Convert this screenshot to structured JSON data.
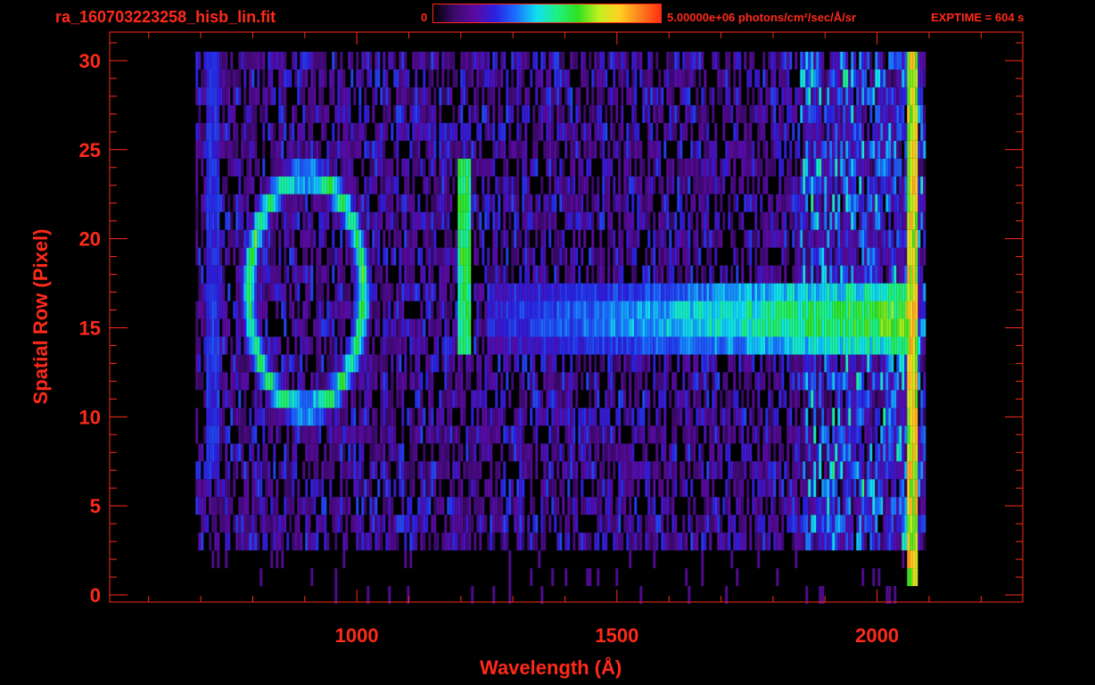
{
  "header": {
    "filename": "ra_160703223258_hisb_lin.fit",
    "colorbar_min": "0",
    "colorbar_max_label": "5.00000e+06 photons/cm²/sec/Å/sr",
    "exptime": "EXPTIME = 604 s"
  },
  "colors": {
    "axis": "#ff2a1a",
    "background": "#000000",
    "colormap": [
      "#000000",
      "#3a0a6a",
      "#5a0aa0",
      "#2a20e0",
      "#1a70ff",
      "#10e0f0",
      "#20f080",
      "#30e020",
      "#c0f020",
      "#ffd020",
      "#ff8020",
      "#ff3010"
    ]
  },
  "chart_data": {
    "type": "heatmap",
    "title": "ra_160703223258_hisb_lin.fit",
    "xlabel": "Wavelength (Å)",
    "ylabel": "Spatial Row (Pixel)",
    "xlim": [
      525,
      2280
    ],
    "ylim": [
      -0.4,
      31.6
    ],
    "x_ticks": [
      1000,
      1500,
      2000
    ],
    "y_ticks": [
      0,
      5,
      10,
      15,
      20,
      25,
      30
    ],
    "colorbar_range": [
      0,
      5000000
    ],
    "colorbar_unit": "photons/cm²/sec/Å/sr",
    "data_x_range": [
      690,
      2090
    ],
    "data_y_range": [
      0,
      30
    ],
    "features": [
      {
        "type": "ring",
        "center_x": 900,
        "center_y": 17,
        "radius_x": 110,
        "radius_y": 6.5,
        "intensity": 0.55
      },
      {
        "type": "vertical_line",
        "x": 1205,
        "y_range": [
          14,
          24
        ],
        "intensity": 0.6
      },
      {
        "type": "horizontal_band",
        "x_range": [
          1250,
          2070
        ],
        "y_range": [
          14,
          18
        ],
        "intensity_start": 0.3,
        "intensity_end": 0.75
      },
      {
        "type": "vertical_line",
        "x": 2065,
        "y_range": [
          1,
          30
        ],
        "intensity": 0.8
      },
      {
        "type": "vertical_line",
        "x": 720,
        "y_range": [
          7,
          30
        ],
        "intensity": 0.3
      }
    ]
  }
}
